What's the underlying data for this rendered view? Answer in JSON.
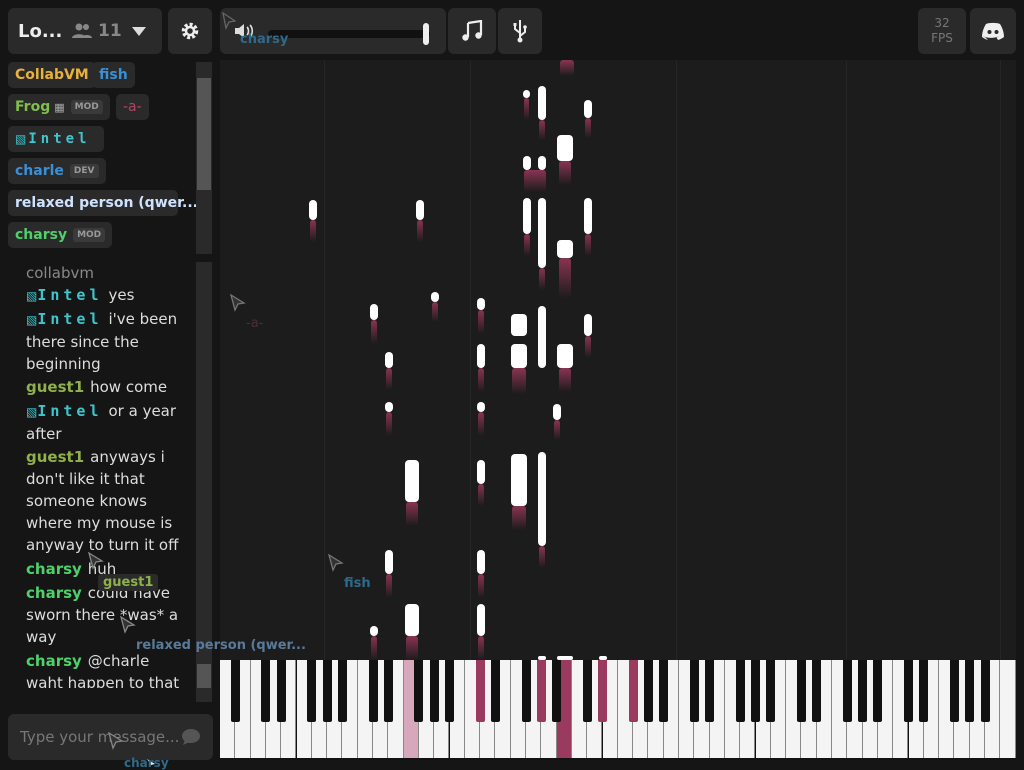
{
  "header": {
    "room_name": "Lo...",
    "user_count": "11",
    "fps_value": "32",
    "fps_label": "FPS",
    "volume": 0.96
  },
  "users": [
    {
      "name": "CollabVM",
      "tag": "",
      "color": "#e8b13a"
    },
    {
      "name": "fish",
      "tag": "",
      "color": "#3a8fd6"
    },
    {
      "name": "Frog",
      "tag": "MOD",
      "color": "#7fbf4a"
    },
    {
      "name": "-a-",
      "tag": "",
      "color": "#b0485f"
    },
    {
      "name": "Intel",
      "tag": "",
      "color": "#3ec6cf"
    },
    {
      "name": "charle",
      "tag": "DEV",
      "color": "#3a8fd6"
    },
    {
      "name": "relaxed person (qwer...",
      "tag": "",
      "color": "#cfe3ff"
    },
    {
      "name": "charsy",
      "tag": "MOD",
      "color": "#4fd06a"
    }
  ],
  "chat": {
    "system": "collabvm",
    "messages": [
      {
        "nick": "Intel",
        "text": "yes"
      },
      {
        "nick": "Intel",
        "text": "i've been there since the beginning"
      },
      {
        "nick": "guest1",
        "text": "how come"
      },
      {
        "nick": "Intel",
        "text": "or a year after"
      },
      {
        "nick": "guest1",
        "text": "anyways i don't like it that someone knows where my mouse is anyway to turn it off"
      },
      {
        "nick": "charsy",
        "text": "huh"
      },
      {
        "nick": "charsy",
        "text": "could have sworn there *was* a way"
      },
      {
        "nick": "charsy",
        "text": "@charle waht happen to that"
      }
    ],
    "input_placeholder": "Type your message..."
  },
  "cursors": [
    {
      "name": "charsy"
    },
    {
      "name": "-a-"
    },
    {
      "name": "fish"
    },
    {
      "name": "guest1"
    },
    {
      "name": "relaxed person (qwer..."
    },
    {
      "name": "charsy"
    }
  ],
  "colors": {
    "background": "#151515",
    "panel": "#2a2a2a",
    "note_trail": "#8a3452",
    "pressed_key": "#9a3a5e",
    "guest": "#8fb04a",
    "charsy": "#4fd06a",
    "intel": "#3ec6cf"
  },
  "icons": [
    "users-icon",
    "chevron-down-icon",
    "gear-icon",
    "volume-icon",
    "music-note-icon",
    "usb-icon",
    "discord-icon",
    "chat-bubble-icon",
    "cursor-icon"
  ]
}
